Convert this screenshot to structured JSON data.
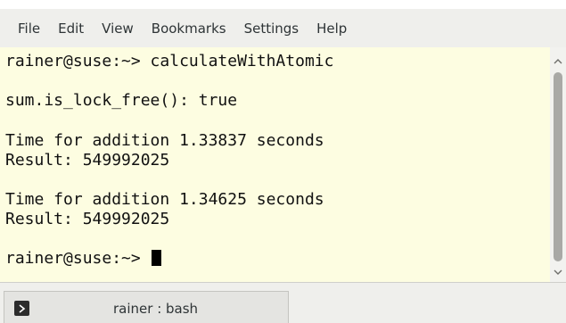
{
  "menubar": {
    "items": [
      "File",
      "Edit",
      "View",
      "Bookmarks",
      "Settings",
      "Help"
    ]
  },
  "terminal": {
    "lines": [
      "rainer@suse:~> calculateWithAtomic",
      "",
      "sum.is_lock_free(): true",
      "",
      "Time for addition 1.33837 seconds",
      "Result: 549992025",
      "",
      "Time for addition 1.34625 seconds",
      "Result: 549992025",
      "",
      "rainer@suse:~> "
    ]
  },
  "tabbar": {
    "tab_label": "rainer : bash",
    "icon": "terminal-icon"
  },
  "colors": {
    "terminal_bg": "#fdfde1",
    "chrome_bg": "#efefec",
    "text": "#111111"
  }
}
